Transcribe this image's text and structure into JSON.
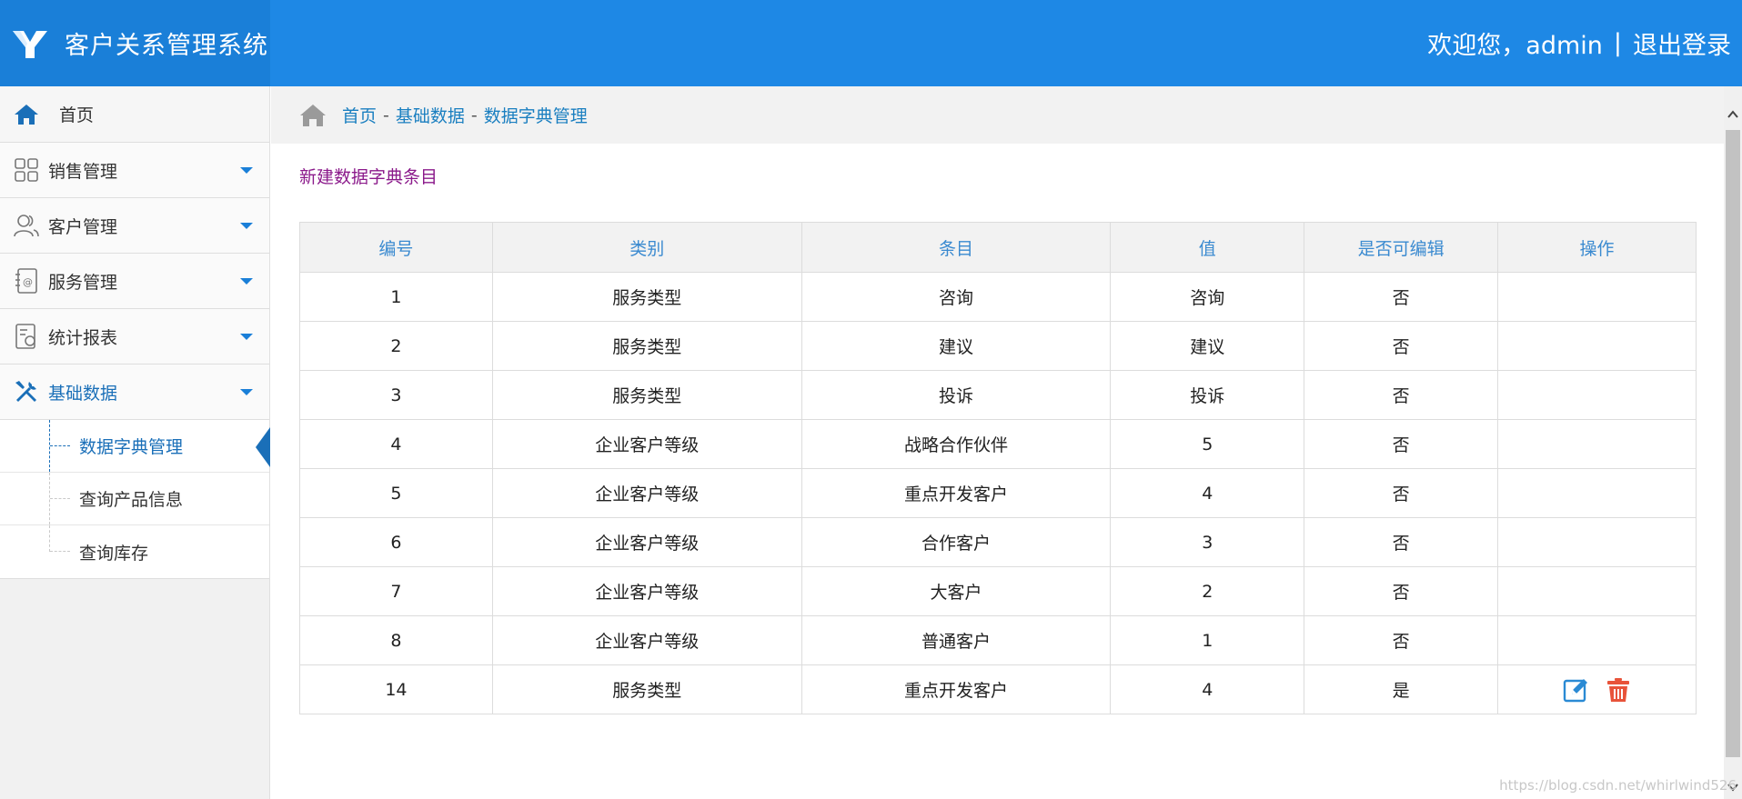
{
  "header": {
    "app_title": "客户关系管理系统",
    "welcome_text": "欢迎您，admin",
    "separator": "|",
    "logout_label": "退出登录",
    "logo_icon": "brand-y-logo-icon",
    "colors": {
      "header_bg": "#1e88e5",
      "brand_bg": "#1a7fd8"
    }
  },
  "sidebar": {
    "home": {
      "label": "首页",
      "icon": "home-icon"
    },
    "items": [
      {
        "label": "销售管理",
        "icon": "grid-icon"
      },
      {
        "label": "客户管理",
        "icon": "users-icon"
      },
      {
        "label": "服务管理",
        "icon": "contacts-book-icon"
      },
      {
        "label": "统计报表",
        "icon": "report-icon"
      },
      {
        "label": "基础数据",
        "icon": "tools-icon",
        "active": true
      }
    ],
    "sub_items": [
      {
        "label": "数据字典管理",
        "active": true
      },
      {
        "label": "查询产品信息"
      },
      {
        "label": "查询库存"
      }
    ]
  },
  "breadcrumb": {
    "items": [
      "首页",
      "基础数据",
      "数据字典管理"
    ],
    "separator": "-"
  },
  "main": {
    "new_link": "新建数据字典条目",
    "table": {
      "columns": [
        "编号",
        "类别",
        "条目",
        "值",
        "是否可编辑",
        "操作"
      ],
      "rows": [
        {
          "id": "1",
          "type": "服务类型",
          "item": "咨询",
          "value": "咨询",
          "editable": "否"
        },
        {
          "id": "2",
          "type": "服务类型",
          "item": "建议",
          "value": "建议",
          "editable": "否"
        },
        {
          "id": "3",
          "type": "服务类型",
          "item": "投诉",
          "value": "投诉",
          "editable": "否"
        },
        {
          "id": "4",
          "type": "企业客户等级",
          "item": "战略合作伙伴",
          "value": "5",
          "editable": "否"
        },
        {
          "id": "5",
          "type": "企业客户等级",
          "item": "重点开发客户",
          "value": "4",
          "editable": "否"
        },
        {
          "id": "6",
          "type": "企业客户等级",
          "item": "合作客户",
          "value": "3",
          "editable": "否"
        },
        {
          "id": "7",
          "type": "企业客户等级",
          "item": "大客户",
          "value": "2",
          "editable": "否"
        },
        {
          "id": "8",
          "type": "企业客户等级",
          "item": "普通客户",
          "value": "1",
          "editable": "否"
        },
        {
          "id": "14",
          "type": "服务类型",
          "item": "重点开发客户",
          "value": "4",
          "editable": "是",
          "actions": [
            "edit-icon",
            "delete-icon"
          ]
        }
      ]
    }
  },
  "watermark": "https://blog.csdn.net/whirlwind526"
}
